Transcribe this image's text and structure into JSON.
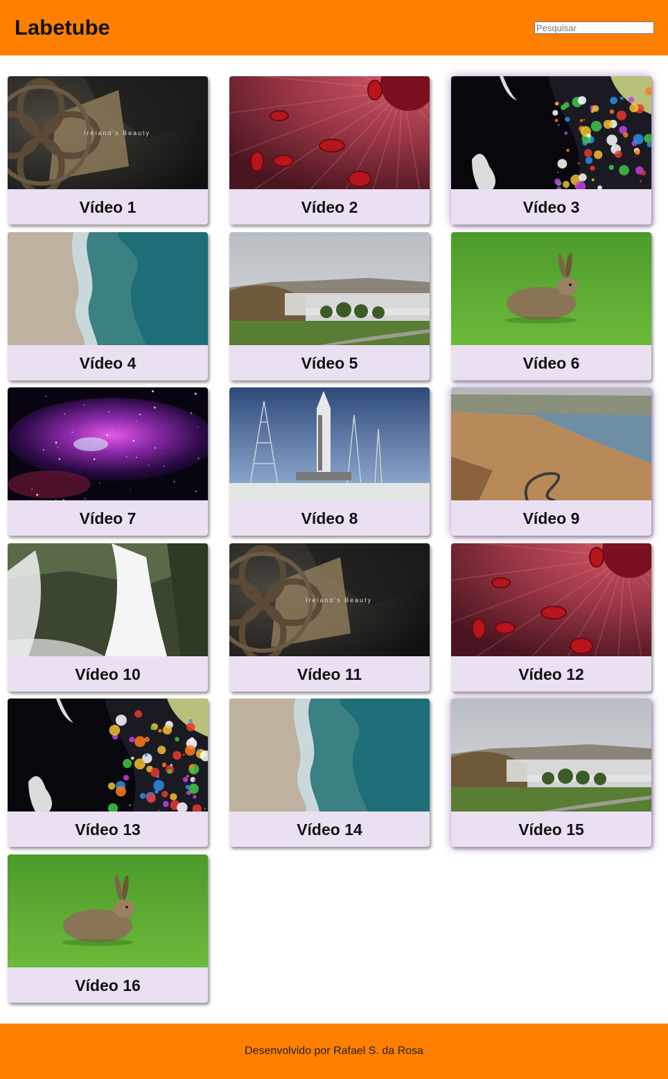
{
  "header": {
    "title": "Labetube",
    "search_placeholder": "Pesquisar",
    "background_color": "#ff7f00"
  },
  "videos": [
    {
      "title": "Vídeo 1",
      "thumbnail": "celtic-cross"
    },
    {
      "title": "Vídeo 2",
      "thumbnail": "red-blood-cells"
    },
    {
      "title": "Vídeo 3",
      "thumbnail": "colorful-ink"
    },
    {
      "title": "Vídeo 4",
      "thumbnail": "beach-aerial"
    },
    {
      "title": "Vídeo 5",
      "thumbnail": "foggy-landscape"
    },
    {
      "title": "Vídeo 6",
      "thumbnail": "hare-on-grass"
    },
    {
      "title": "Vídeo 7",
      "thumbnail": "purple-nebula"
    },
    {
      "title": "Vídeo 8",
      "thumbnail": "rocket-launch-pad"
    },
    {
      "title": "Vídeo 9",
      "thumbnail": "river-canyon-road"
    },
    {
      "title": "Vídeo 10",
      "thumbnail": "waterfall"
    },
    {
      "title": "Vídeo 11",
      "thumbnail": "celtic-cross"
    },
    {
      "title": "Vídeo 12",
      "thumbnail": "red-blood-cells"
    },
    {
      "title": "Vídeo 13",
      "thumbnail": "colorful-ink"
    },
    {
      "title": "Vídeo 14",
      "thumbnail": "beach-aerial"
    },
    {
      "title": "Vídeo 15",
      "thumbnail": "foggy-landscape"
    },
    {
      "title": "Vídeo 16",
      "thumbnail": "hare-on-grass"
    }
  ],
  "thumbnail_text": {
    "celtic-cross": "Ireland's Beauty"
  },
  "footer": {
    "credit": "Desenvolvido por Rafael S. da Rosa",
    "background_color": "#ff7f00"
  },
  "colors": {
    "card_background": "#ebe0f2",
    "accent": "#ff7f00"
  }
}
